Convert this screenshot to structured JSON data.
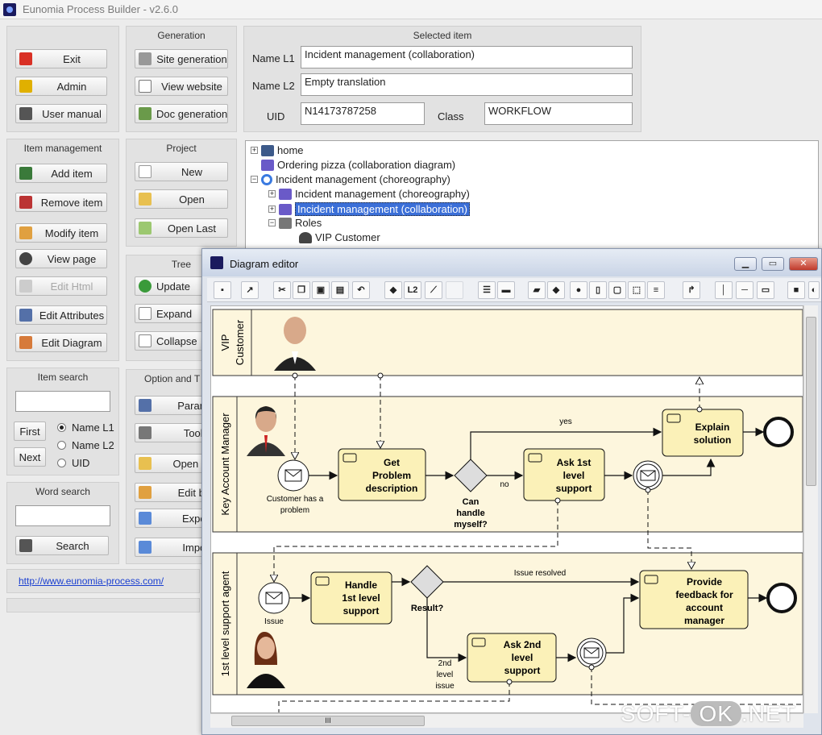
{
  "app": {
    "title": "Eunomia Process Builder - v2.6.0"
  },
  "general": {
    "exit": "Exit",
    "admin": "Admin",
    "user_manual": "User manual"
  },
  "generation": {
    "header": "Generation",
    "site": "Site generation",
    "view": "View website",
    "doc": "Doc generation"
  },
  "selected": {
    "header": "Selected item",
    "name_l1_label": "Name L1",
    "name_l1": "Incident management (collaboration)",
    "name_l2_label": "Name L2",
    "name_l2": "Empty translation",
    "uid_label": "UID",
    "uid": "N14173787258",
    "class_label": "Class",
    "class": "WORKFLOW"
  },
  "item_mgmt": {
    "header": "Item management",
    "add": "Add item",
    "remove": "Remove item",
    "modify": "Modify item",
    "view": "View page",
    "edit_html": "Edit Html",
    "edit_attr": "Edit Attributes",
    "edit_diag": "Edit Diagram"
  },
  "project": {
    "header": "Project",
    "new": "New",
    "open": "Open",
    "open_last": "Open Last"
  },
  "tree_panel": {
    "header": "Tree",
    "update": "Update",
    "expand": "Expand",
    "collapse": "Collapse"
  },
  "item_search": {
    "header": "Item search",
    "first": "First",
    "next": "Next",
    "opt1": "Name L1",
    "opt2": "Name L2",
    "opt3": "UID"
  },
  "options": {
    "header": "Option and T",
    "param": "Parame",
    "tools": "Tools",
    "open_dir": "Open dire",
    "edit_bar": "Edit bar",
    "export": "Expor",
    "import": "Impor"
  },
  "word_search": {
    "header": "Word search",
    "search": "Search"
  },
  "link": {
    "url": "http://www.eunomia-process.com/"
  },
  "tree": {
    "home": "home",
    "ordering": "Ordering pizza (collaboration diagram)",
    "incident": "Incident management  (choreography)",
    "child1": "Incident management (choreography)",
    "child2": "Incident management (collaboration)",
    "roles": "Roles",
    "vip": "VIP Customer"
  },
  "editor": {
    "title": "Diagram editor",
    "lanes": [
      "VIP Customer",
      "Key Account Manager",
      "1st level support agent"
    ],
    "lane1_a": "VIP",
    "lane1_b": "Customer",
    "tasks": {
      "get_problem": [
        "Get",
        "Problem",
        "description"
      ],
      "ask_1st": [
        "Ask 1st",
        "level",
        "support"
      ],
      "explain": [
        "Explain",
        "solution"
      ],
      "handle": [
        "Handle",
        "1st level",
        "support"
      ],
      "provide": [
        "Provide",
        "feedback for",
        "account",
        "manager"
      ],
      "ask_2nd": [
        "Ask 2nd",
        "level",
        "support"
      ]
    },
    "labels": {
      "customer_problem_1": "Customer has a",
      "customer_problem_2": "problem",
      "can_handle": [
        "Can",
        "handle",
        "myself?"
      ],
      "yes": "yes",
      "no": "no",
      "issue": "Issue",
      "result": "Result?",
      "issue_resolved": "Issue resolved",
      "second_level": [
        "2nd",
        "level",
        "issue"
      ]
    },
    "scroll_grip": "III"
  },
  "watermark": {
    "a": "SOFT-",
    "b": "OK",
    "c": ".NET"
  },
  "colors": {
    "task_fill": "#fbf1b8",
    "lane_fill": "#fdf6dd",
    "selection": "#3b6fd8",
    "window_bg": "#ececec"
  }
}
